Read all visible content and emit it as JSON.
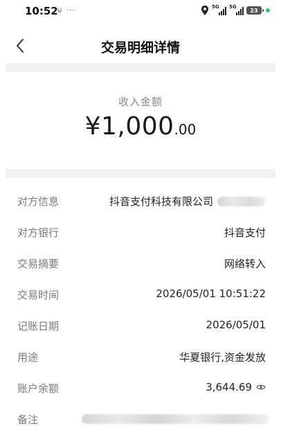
{
  "status_bar": {
    "time": "10:52",
    "extra": "⊌ ···",
    "signal1_label": "5G",
    "signal2_label": "5G",
    "battery": "23"
  },
  "nav": {
    "title": "交易明细详情",
    "back_icon": "chevron-left-icon"
  },
  "amount": {
    "label": "收入金额",
    "main": "¥1,000",
    "decimal": ".00"
  },
  "details": [
    {
      "key": "对方信息",
      "value": "抖音支付科技有限公司"
    },
    {
      "key": "对方银行",
      "value": "抖音支付"
    },
    {
      "key": "交易摘要",
      "value": "网络转入"
    },
    {
      "key": "交易时间",
      "value": "2026/05/01 10:51:22"
    },
    {
      "key": "记账日期",
      "value": "2026/05/01"
    },
    {
      "key": "用途",
      "value": "华夏银行,资金发放"
    },
    {
      "key": "账户余额",
      "value": "3,644.69"
    },
    {
      "key": "备注",
      "value": ""
    }
  ],
  "colors": {
    "band": "#f1f1f1",
    "label_gray": "#7a7a7a",
    "text_dark": "#222222",
    "status_green": "#2ecc71"
  }
}
